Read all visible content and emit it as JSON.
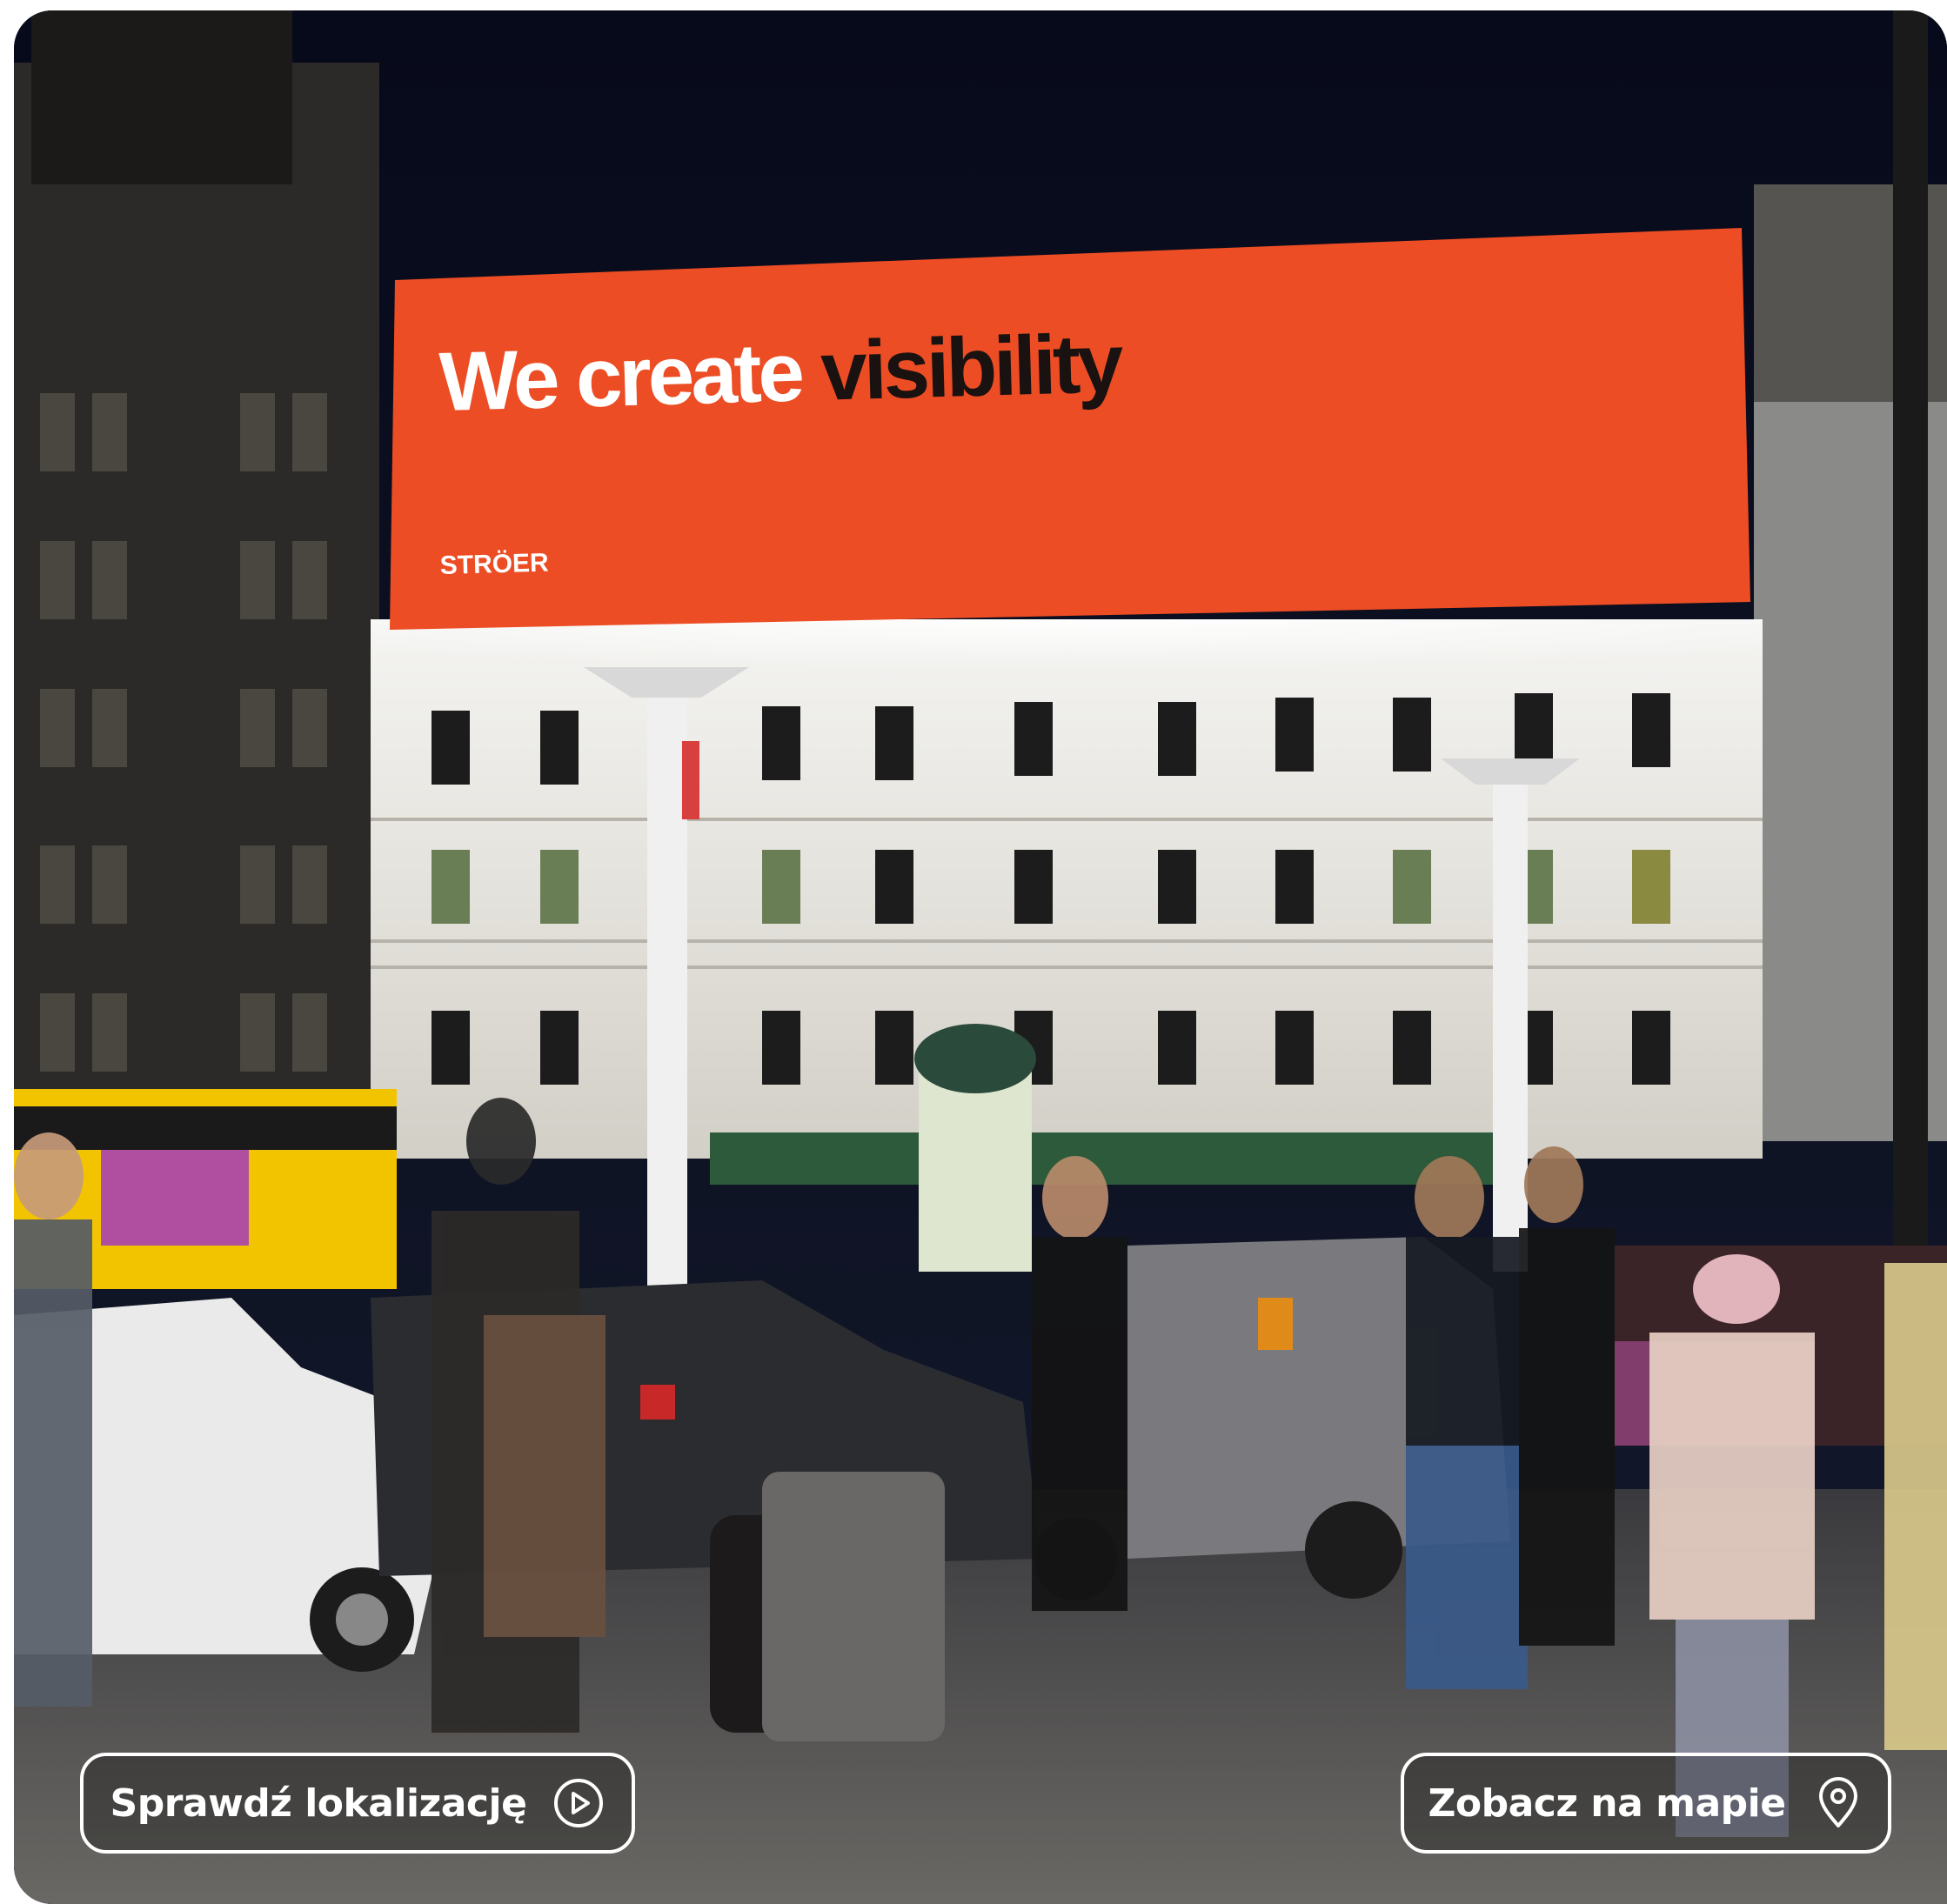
{
  "billboard": {
    "headline_light": "We create",
    "headline_bold": "visibility",
    "brand": "STRÖER",
    "color": "#ec4d24"
  },
  "actions": {
    "check_location_label": "Sprawdź lokalizację",
    "check_location_icon": "play-circle-icon",
    "view_map_label": "Zobacz na mapie",
    "view_map_icon": "map-pin-icon"
  },
  "colors": {
    "button_border": "#ffffff",
    "sky": "#0a0d1e",
    "bus": "#f2c400"
  }
}
